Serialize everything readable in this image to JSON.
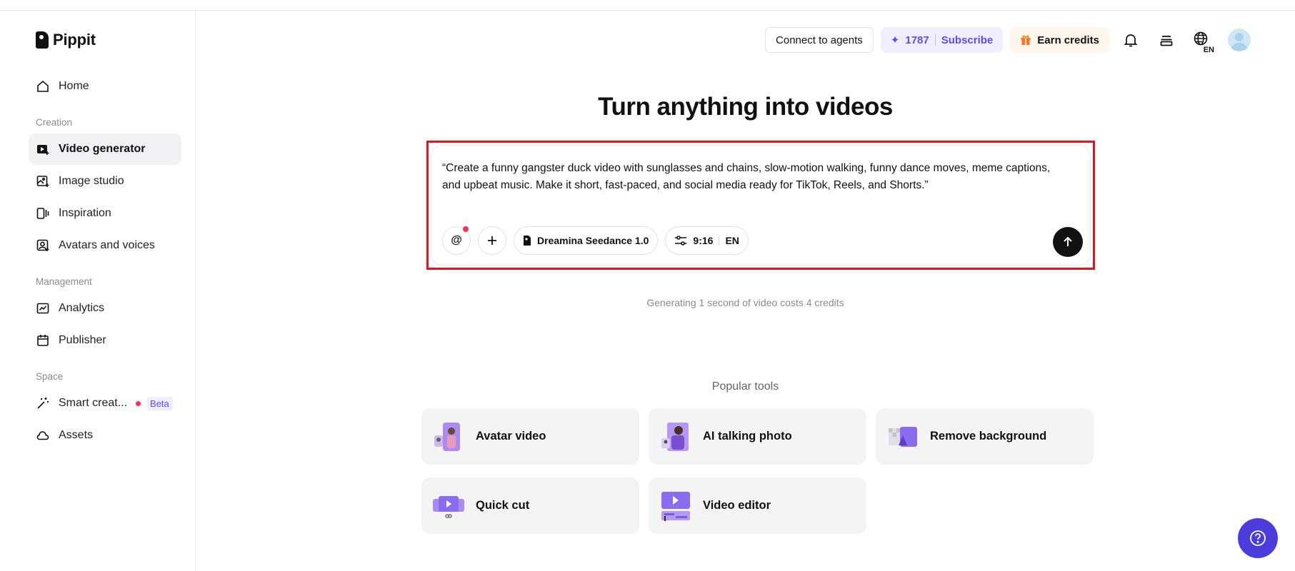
{
  "brand": {
    "name": "Pippit"
  },
  "sidebar": {
    "home": "Home",
    "sections": {
      "creation": "Creation",
      "management": "Management",
      "space": "Space"
    },
    "creation_items": [
      "Video generator",
      "Image studio",
      "Inspiration",
      "Avatars and voices"
    ],
    "management_items": [
      "Analytics",
      "Publisher"
    ],
    "space_items": [
      "Smart creat...",
      "Assets"
    ],
    "beta_badge": "Beta"
  },
  "topbar": {
    "connect_agents": "Connect to agents",
    "credits": "1787",
    "subscribe": "Subscribe",
    "earn_credits": "Earn credits",
    "language_code": "EN"
  },
  "main": {
    "headline": "Turn anything into videos",
    "prompt_text": "“Create a funny gangster duck video with sunglasses and chains, slow-motion walking, funny dance moves, meme captions, and upbeat music. Make it short, fast-paced, and social media ready for TikTok, Reels, and Shorts.”",
    "model_name": "Dreamina Seedance 1.0",
    "aspect_ratio": "9:16",
    "language": "EN",
    "cost_note": "Generating 1 second of video costs 4 credits",
    "popular_title": "Popular tools",
    "tools": [
      "Avatar video",
      "AI talking photo",
      "Remove background",
      "Quick cut",
      "Video editor"
    ]
  },
  "colors": {
    "accent": "#5b4cf0",
    "highlight_frame": "#e3141d",
    "help_button": "#4a3ddb"
  }
}
